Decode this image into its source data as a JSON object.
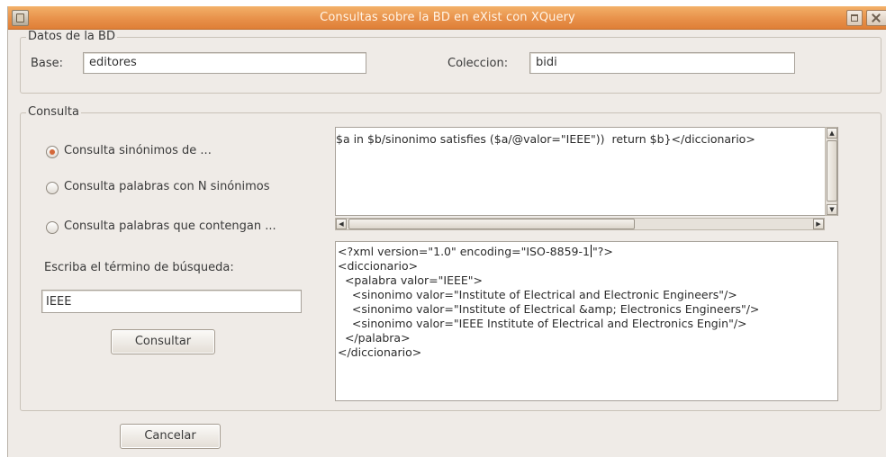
{
  "window": {
    "title": "Consultas sobre la BD  en eXist con XQuery"
  },
  "datos_bd": {
    "legend": "Datos de la BD",
    "base_label": "Base:",
    "base_value": "editores",
    "coleccion_label": "Coleccion:",
    "coleccion_value": "bidi"
  },
  "consulta": {
    "legend": "Consulta",
    "options": [
      {
        "label": "Consulta sinónimos de ...",
        "checked": true
      },
      {
        "label": "Consulta palabras con N sinónimos",
        "checked": false
      },
      {
        "label": "Consulta palabras que contengan ...",
        "checked": false
      }
    ],
    "search_label": "Escriba el término de búsqueda:",
    "search_value": "IEEE",
    "consultar_button": "Consultar"
  },
  "query_editor": {
    "text": "$a in $b/sinonimo satisfies ($a/@valor=\"IEEE\"))  return $b}</diccionario>"
  },
  "result": {
    "line1_before_caret": "<?xml version=\"1.0\" encoding=\"ISO-8859-1",
    "line1_after_caret": "\"?>",
    "lines": [
      "<diccionario>",
      "  <palabra valor=\"IEEE\">",
      "    <sinonimo valor=\"Institute of Electrical and Electronic Engineers\"/>",
      "    <sinonimo valor=\"Institute of Electrical &amp; Electronics Engineers\"/>",
      "    <sinonimo valor=\"IEEE Institute of Electrical and Electronics Engin\"/>",
      "  </palabra>",
      "</diccionario>"
    ]
  },
  "cancel_button": "Cancelar"
}
